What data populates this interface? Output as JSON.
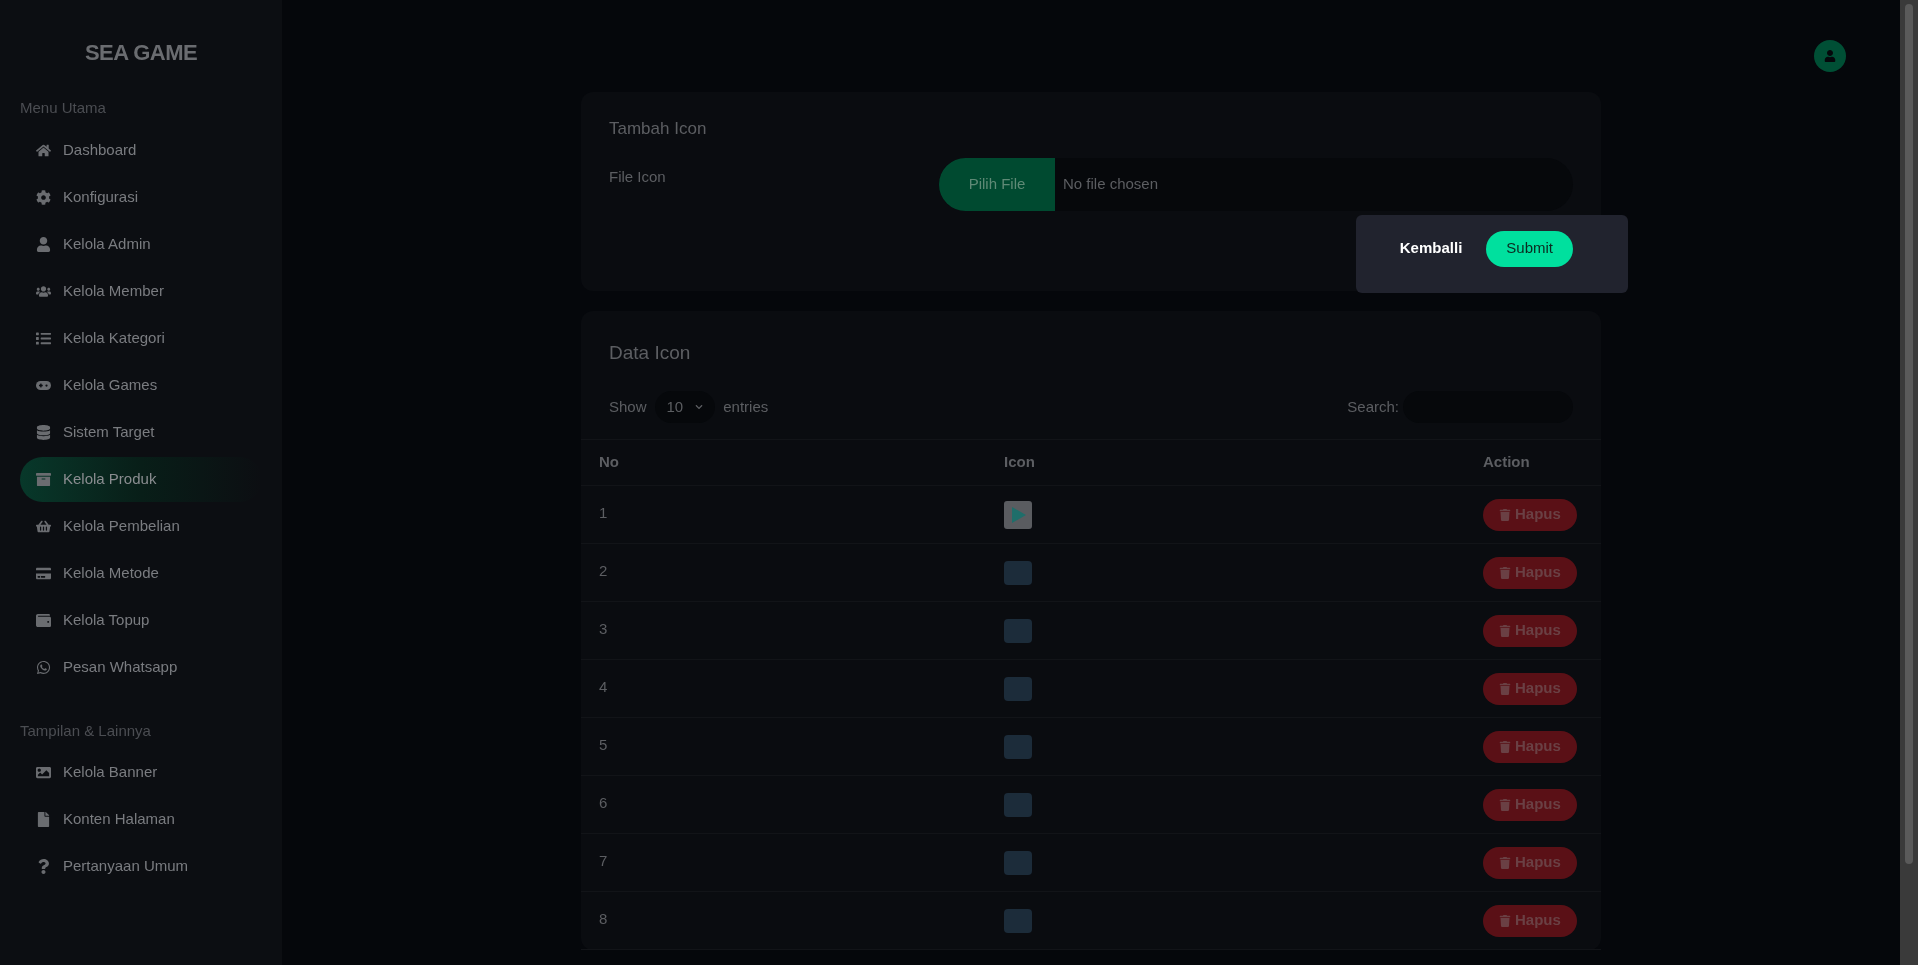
{
  "sidebar": {
    "logo": "SEA GAME",
    "sections": [
      {
        "heading": "Menu Utama",
        "items": [
          {
            "label": "Dashboard",
            "selected": false
          },
          {
            "label": "Konfigurasi",
            "selected": false
          },
          {
            "label": "Kelola Admin",
            "selected": false
          },
          {
            "label": "Kelola Member",
            "selected": false
          },
          {
            "label": "Kelola Kategori",
            "selected": false
          },
          {
            "label": "Kelola Games",
            "selected": false
          },
          {
            "label": "Sistem Target",
            "selected": false
          },
          {
            "label": "Kelola Produk",
            "selected": true
          },
          {
            "label": "Kelola Pembelian",
            "selected": false
          },
          {
            "label": "Kelola Metode",
            "selected": false
          },
          {
            "label": "Kelola Topup",
            "selected": false
          },
          {
            "label": "Pesan Whatsapp",
            "selected": false
          }
        ]
      },
      {
        "heading": "Tampilan & Lainnya",
        "items": [
          {
            "label": "Kelola Banner",
            "selected": false
          },
          {
            "label": "Konten Halaman",
            "selected": false
          },
          {
            "label": "Pertanyaan Umum",
            "selected": false
          }
        ]
      }
    ]
  },
  "form": {
    "title": "Tambah Icon",
    "field_label": "File Icon",
    "file_button": "Pilih File",
    "file_status": "No file chosen",
    "back_button": "Kemballi",
    "submit_button": "Submit"
  },
  "table_card": {
    "title": "Data Icon",
    "show_label": "Show",
    "entries_value": "10",
    "entries_label": "entries",
    "search_label": "Search:",
    "columns": [
      "No",
      "Icon",
      "Action"
    ],
    "rows": [
      {
        "no": "1",
        "kind": "play",
        "action": "Hapus"
      },
      {
        "no": "2",
        "kind": "image",
        "action": "Hapus"
      },
      {
        "no": "3",
        "kind": "image",
        "action": "Hapus"
      },
      {
        "no": "4",
        "kind": "image",
        "action": "Hapus"
      },
      {
        "no": "5",
        "kind": "image",
        "action": "Hapus"
      },
      {
        "no": "6",
        "kind": "image",
        "action": "Hapus"
      },
      {
        "no": "7",
        "kind": "image",
        "action": "Hapus"
      },
      {
        "no": "8",
        "kind": "image",
        "action": "Hapus"
      }
    ]
  }
}
